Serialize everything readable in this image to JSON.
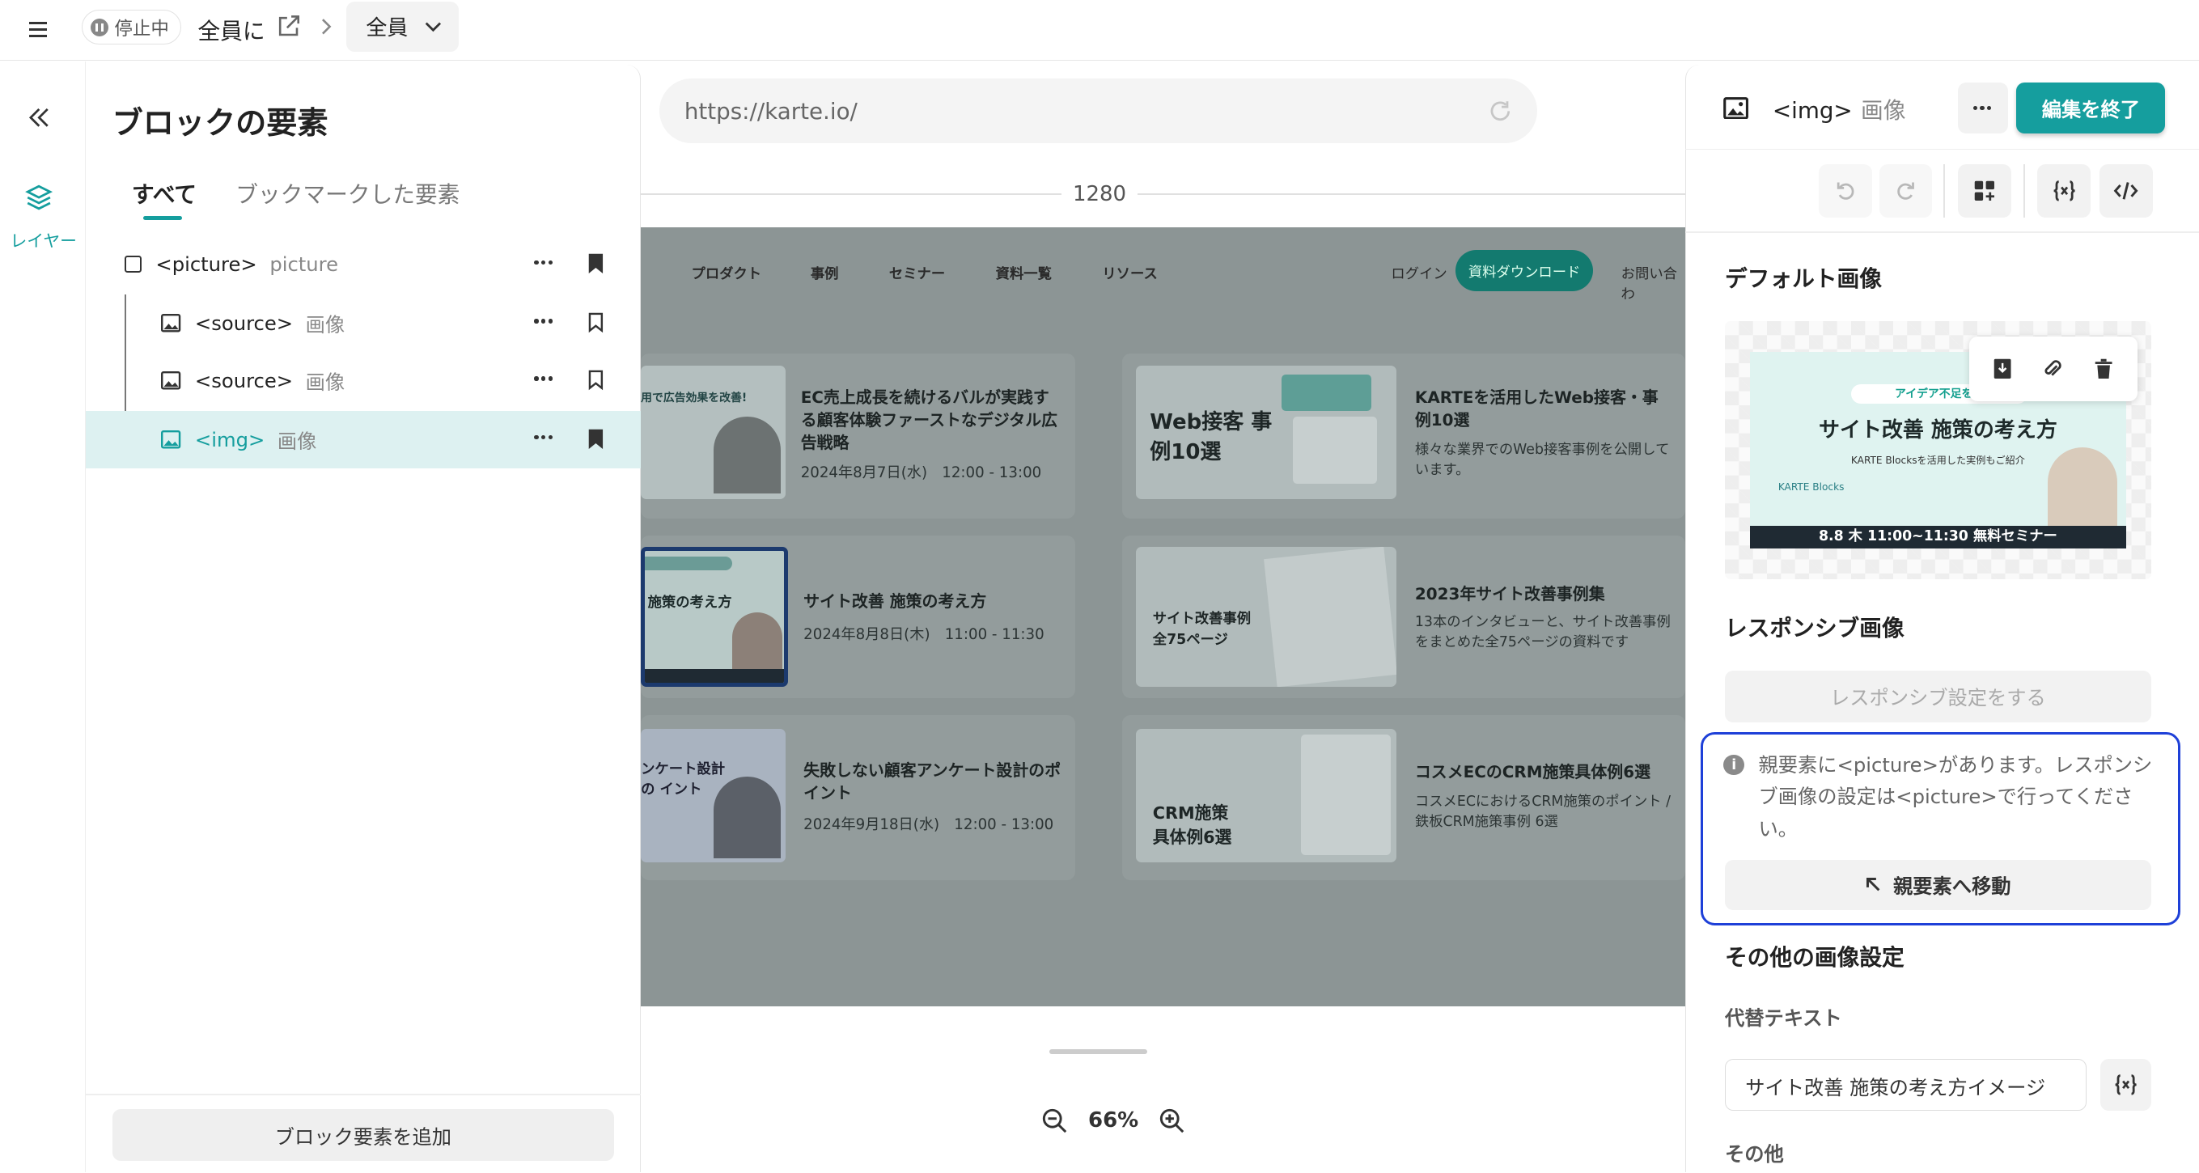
{
  "topbar": {
    "status_label": "停止中",
    "audience_label": "全員に",
    "segment_label": "全員"
  },
  "rail": {
    "layers_label": "レイヤー"
  },
  "left_panel": {
    "title": "ブロックの要素",
    "tabs": [
      {
        "label": "すべて",
        "active": true
      },
      {
        "label": "ブックマークした要素",
        "active": false
      }
    ],
    "tree": [
      {
        "tag": "<picture>",
        "kind": "picture",
        "bookmarked": true,
        "selected": false
      },
      {
        "tag": "<source>",
        "kind": "画像",
        "bookmarked": false,
        "selected": false
      },
      {
        "tag": "<source>",
        "kind": "画像",
        "bookmarked": false,
        "selected": false
      },
      {
        "tag": "<img>",
        "kind": "画像",
        "bookmarked": true,
        "selected": true
      }
    ],
    "add_button": "ブロック要素を追加"
  },
  "canvas": {
    "url": "https://karte.io/",
    "width_label": "1280",
    "zoom_label": "66%",
    "site": {
      "nav": [
        "プロダクト",
        "事例",
        "セミナー",
        "資料一覧",
        "リソース"
      ],
      "login": "ログイン",
      "download": "資料ダウンロード",
      "contact": "お問い合わ",
      "cards": [
        {
          "title": "EC売上成長を続けるバルが実践する顧客体験ファーストなデジタル広告戦略",
          "date": "2024年8月7日(水)　12:00 - 13:00",
          "thumb": "用で広告効果を改善!"
        },
        {
          "title": "KARTEを活用したWeb接客・事例10選",
          "desc": "様々な業界でのWeb接客事例を公開しています。",
          "thumb": "Web接客 事例10選"
        },
        {
          "title": "サイト改善 施策の考え方",
          "date": "2024年8月8日(木)　11:00 - 11:30",
          "thumb": "施策の考え方"
        },
        {
          "title": "2023年サイト改善事例集",
          "desc": "13本のインタビューと、サイト改善事例をまとめた全75ページの資料です",
          "thumb": "サイト改善事例 全75ページ"
        },
        {
          "title": "失敗しない顧客アンケート設計のポイント",
          "date": "2024年9月18日(水)　12:00 - 13:00",
          "thumb": "ンケート設計の イント"
        },
        {
          "title": "コスメECのCRM施策具体例6選",
          "desc": "コスメECにおけるCRM施策のポイント / 鉄板CRM施策事例 6選",
          "thumb": "CRM施策 具体例6選"
        }
      ]
    }
  },
  "right_panel": {
    "selected_tag": "<img>",
    "selected_kind": "画像",
    "finish_button": "編集を終了",
    "default_image_heading": "デフォルト画像",
    "banner": {
      "pill": "アイデア不足を解",
      "title": "サイト改善 施策の考え方",
      "subtitle": "KARTE Blocksを活用した実例もご紹介",
      "brand": "KARTE Blocks",
      "footer": "8.8 木 11:00~11:30 無料セミナー"
    },
    "responsive_heading": "レスポンシブ画像",
    "responsive_button": "レスポンシブ設定をする",
    "notice_text": "親要素に<picture>があります。レスポンシブ画像の設定は<picture>で行ってください。",
    "goto_parent_button": "親要素へ移動",
    "other_settings_heading": "その他の画像設定",
    "alt_label": "代替テキスト",
    "alt_value": "サイト改善 施策の考え方イメージ",
    "other_label": "その他"
  },
  "colors": {
    "accent": "#159e9e",
    "selected_row": "#ddf1f1",
    "notice_border": "#1e40d8"
  }
}
